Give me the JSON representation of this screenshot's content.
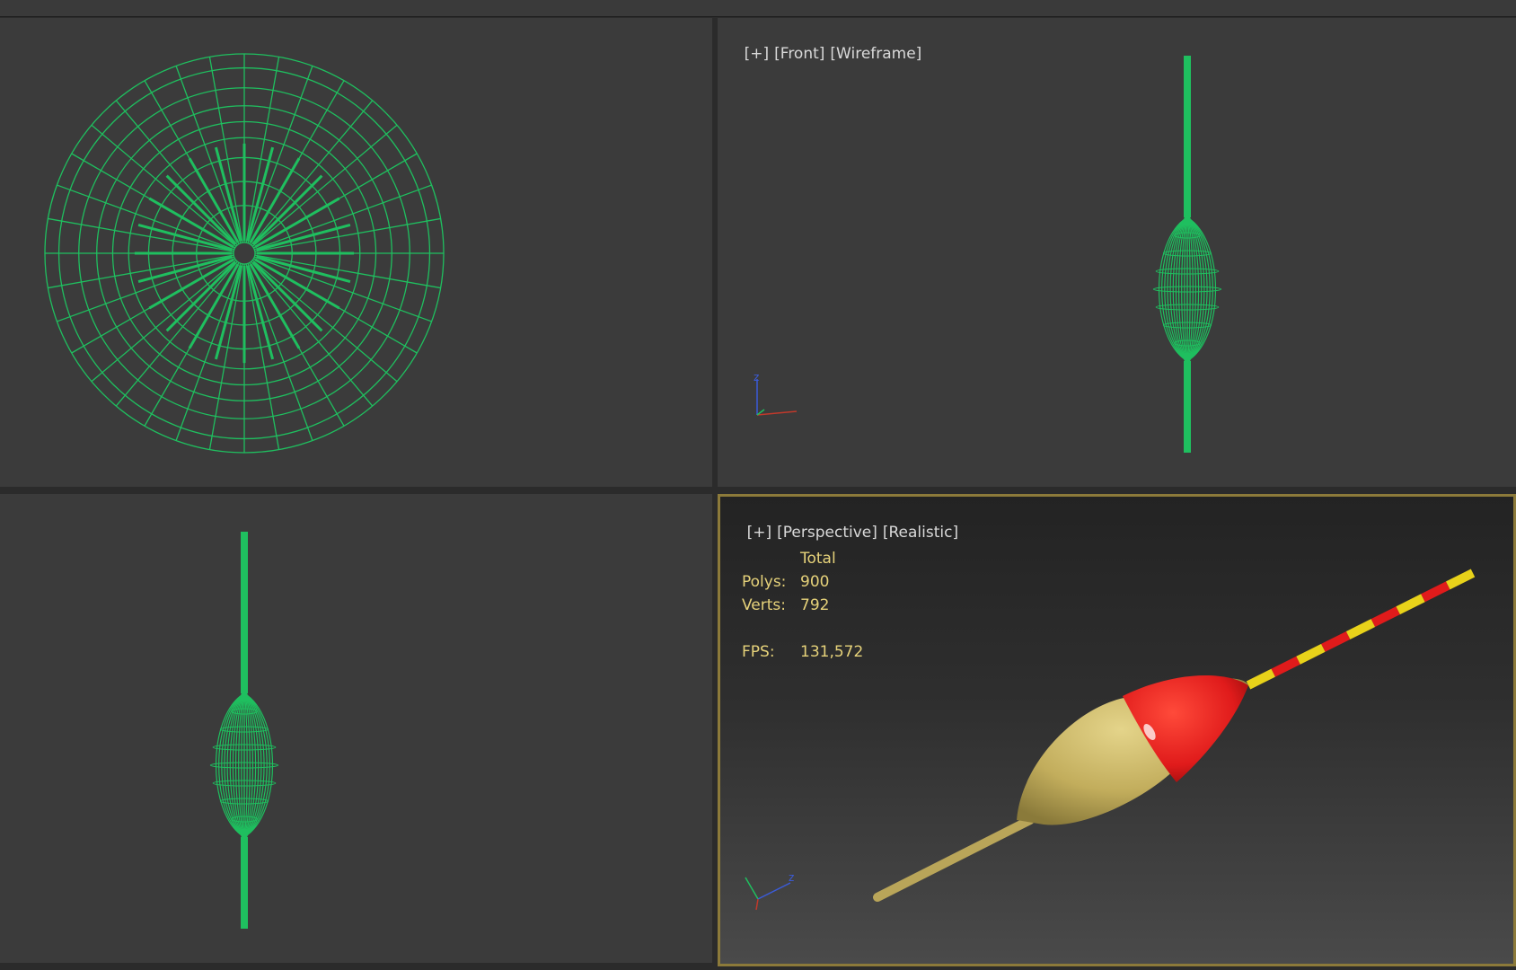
{
  "viewports": {
    "top": {
      "label": ""
    },
    "front": {
      "labels": [
        "[+]",
        "[Front]",
        "[Wireframe]"
      ]
    },
    "left": {
      "label": ""
    },
    "perspective": {
      "labels": [
        "[+]",
        "[Perspective]",
        "[Realistic]"
      ],
      "stats": {
        "header": "Total",
        "polys_label": "Polys:",
        "polys": "900",
        "verts_label": "Verts:",
        "verts": "792",
        "fps_label": "FPS:",
        "fps": "131,572"
      }
    }
  },
  "axis": {
    "z": "z",
    "y": "y",
    "x": "x"
  },
  "colors": {
    "wire": "#1fbf5f",
    "viewport_bg": "#3b3b3b",
    "active_border": "#8c7a3a",
    "float_body": "#c9b463",
    "float_cap": "#e01b1b",
    "tip_yellow": "#e8d21a"
  }
}
